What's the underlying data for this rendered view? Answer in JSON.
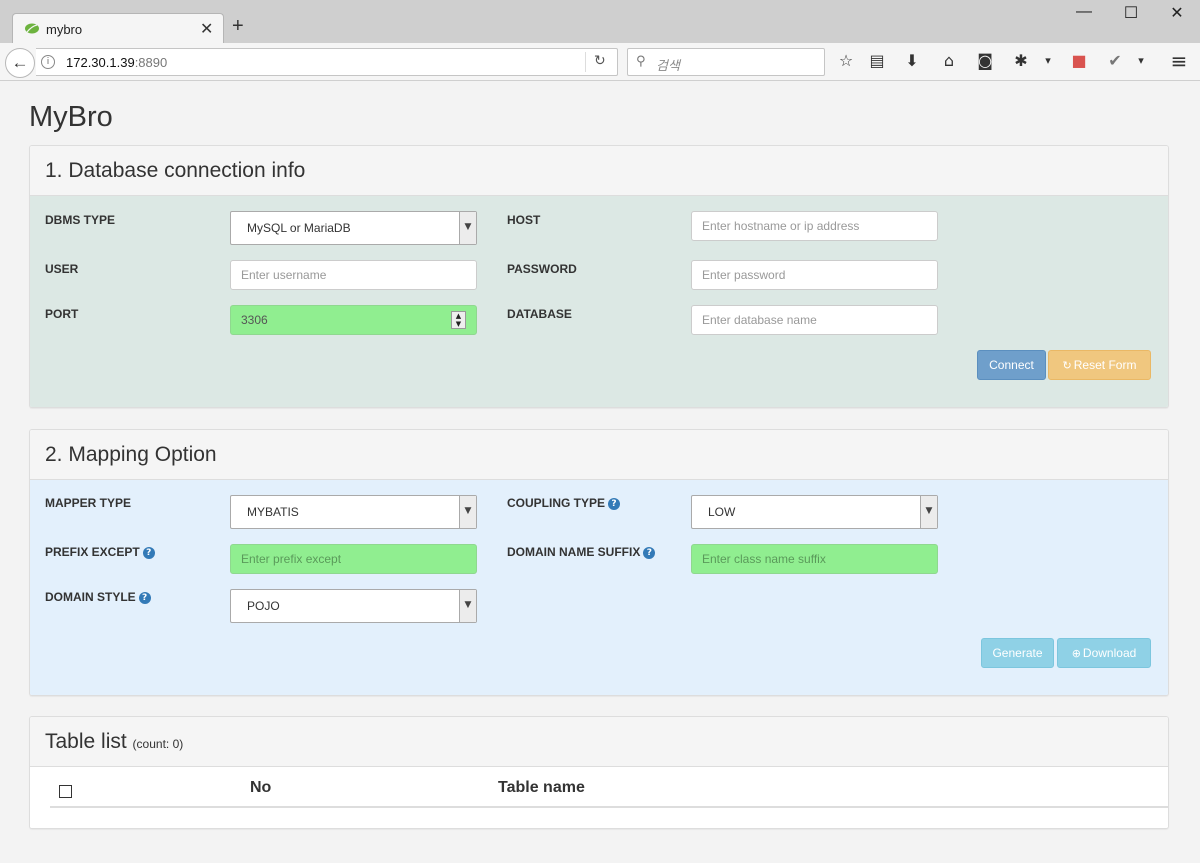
{
  "browser": {
    "tab_title": "mybro",
    "tab_close": "✕",
    "new_tab": "+",
    "win_min": "—",
    "win_max": "☐",
    "win_close": "✕",
    "back": "←",
    "info": "i",
    "url_host": "172.30.1.39",
    "url_port": ":8890",
    "reload": "↻",
    "search_glass": "⚲",
    "search_placeholder": "검색",
    "toolbar_icons": [
      "star-icon",
      "reading-list-icon",
      "download-icon",
      "home-icon",
      "pocket-icon",
      "extension-icon",
      "dropdown-icon",
      "addon-icon",
      "check-icon",
      "dropdown-icon",
      "menu-icon"
    ],
    "toolbar_glyphs": [
      "☆",
      "▤",
      "⬇",
      "⌂",
      "◙",
      "✱",
      "▾",
      "■",
      "✔",
      "▾",
      "≡"
    ]
  },
  "page": {
    "title": "MyBro"
  },
  "db_panel": {
    "title": "1. Database connection info",
    "dbms_type_label": "DBMS TYPE",
    "dbms_type_value": "MySQL or MariaDB",
    "host_label": "HOST",
    "host_placeholder": "Enter hostname or ip address",
    "user_label": "USER",
    "user_placeholder": "Enter username",
    "password_label": "PASSWORD",
    "password_placeholder": "Enter password",
    "port_label": "PORT",
    "port_value": "3306",
    "database_label": "DATABASE",
    "database_placeholder": "Enter database name",
    "connect_label": "Connect",
    "reset_icon": "↻",
    "reset_label": "Reset Form",
    "body_color": "#dce8e4",
    "connect_color": "#6f9fcb",
    "reset_color": "#f0c77f"
  },
  "mapping_panel": {
    "title": "2. Mapping Option",
    "mapper_type_label": "MAPPER TYPE",
    "mapper_type_value": "MYBATIS",
    "coupling_type_label": "COUPLING TYPE",
    "coupling_type_value": "LOW",
    "prefix_except_label": "PREFIX EXCEPT",
    "prefix_except_placeholder": "Enter prefix except",
    "domain_suffix_label": "DOMAIN NAME SUFFIX",
    "domain_suffix_placeholder": "Enter class name suffix",
    "domain_style_label": "DOMAIN STYLE",
    "domain_style_value": "POJO",
    "help_glyph": "?",
    "generate_label": "Generate",
    "download_icon": "⊕",
    "download_label": "Download",
    "body_color": "#e3f0fc",
    "button_color": "#8fd1e6"
  },
  "table_panel": {
    "title": "Table list",
    "count_text": "(count: 0)",
    "col_no": "No",
    "col_table_name": "Table name"
  }
}
